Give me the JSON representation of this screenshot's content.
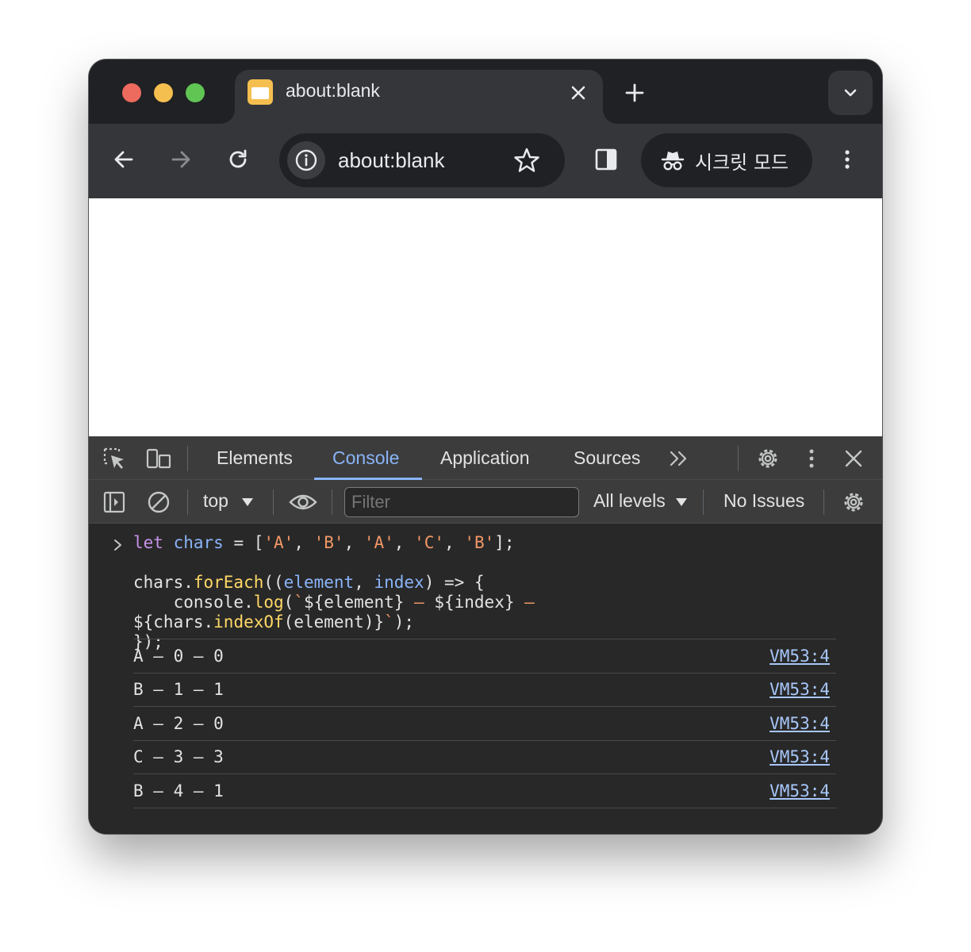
{
  "tab": {
    "title": "about:blank",
    "favicon": "page-favicon-icon"
  },
  "toolbar": {
    "url": "about:blank",
    "incognito_label": "시크릿 모드",
    "icons": [
      "back-arrow-icon",
      "forward-arrow-icon",
      "reload-icon",
      "site-info-icon",
      "bookmark-star-icon",
      "side-panel-icon",
      "incognito-icon",
      "more-vert-icon"
    ]
  },
  "devtools": {
    "tabs": [
      {
        "label": "Elements"
      },
      {
        "label": "Console"
      },
      {
        "label": "Application"
      },
      {
        "label": "Sources"
      }
    ],
    "active_tab": "Console",
    "context": "top",
    "filter_placeholder": "Filter",
    "levels": "All levels",
    "issues": "No Issues"
  },
  "console": {
    "input_code": [
      "let chars = ['A', 'B', 'A', 'C', 'B'];",
      "",
      "chars.forEach((element, index) => {",
      "    console.log(`${element} – ${index} –",
      "${chars.indexOf(element)}`);",
      "});"
    ],
    "logs": [
      {
        "text": "A – 0 – 0",
        "source": "VM53:4"
      },
      {
        "text": "B – 1 – 1",
        "source": "VM53:4"
      },
      {
        "text": "A – 2 – 0",
        "source": "VM53:4"
      },
      {
        "text": "C – 3 – 3",
        "source": "VM53:4"
      },
      {
        "text": "B – 4 – 1",
        "source": "VM53:4"
      }
    ]
  },
  "colors": {
    "frame": "#202124",
    "toolbar": "#35363a",
    "devtools_bg": "#282828",
    "accent": "#8ab4f8",
    "keyword": "#c792ea",
    "string": "#f29766",
    "function": "#ffd866"
  }
}
